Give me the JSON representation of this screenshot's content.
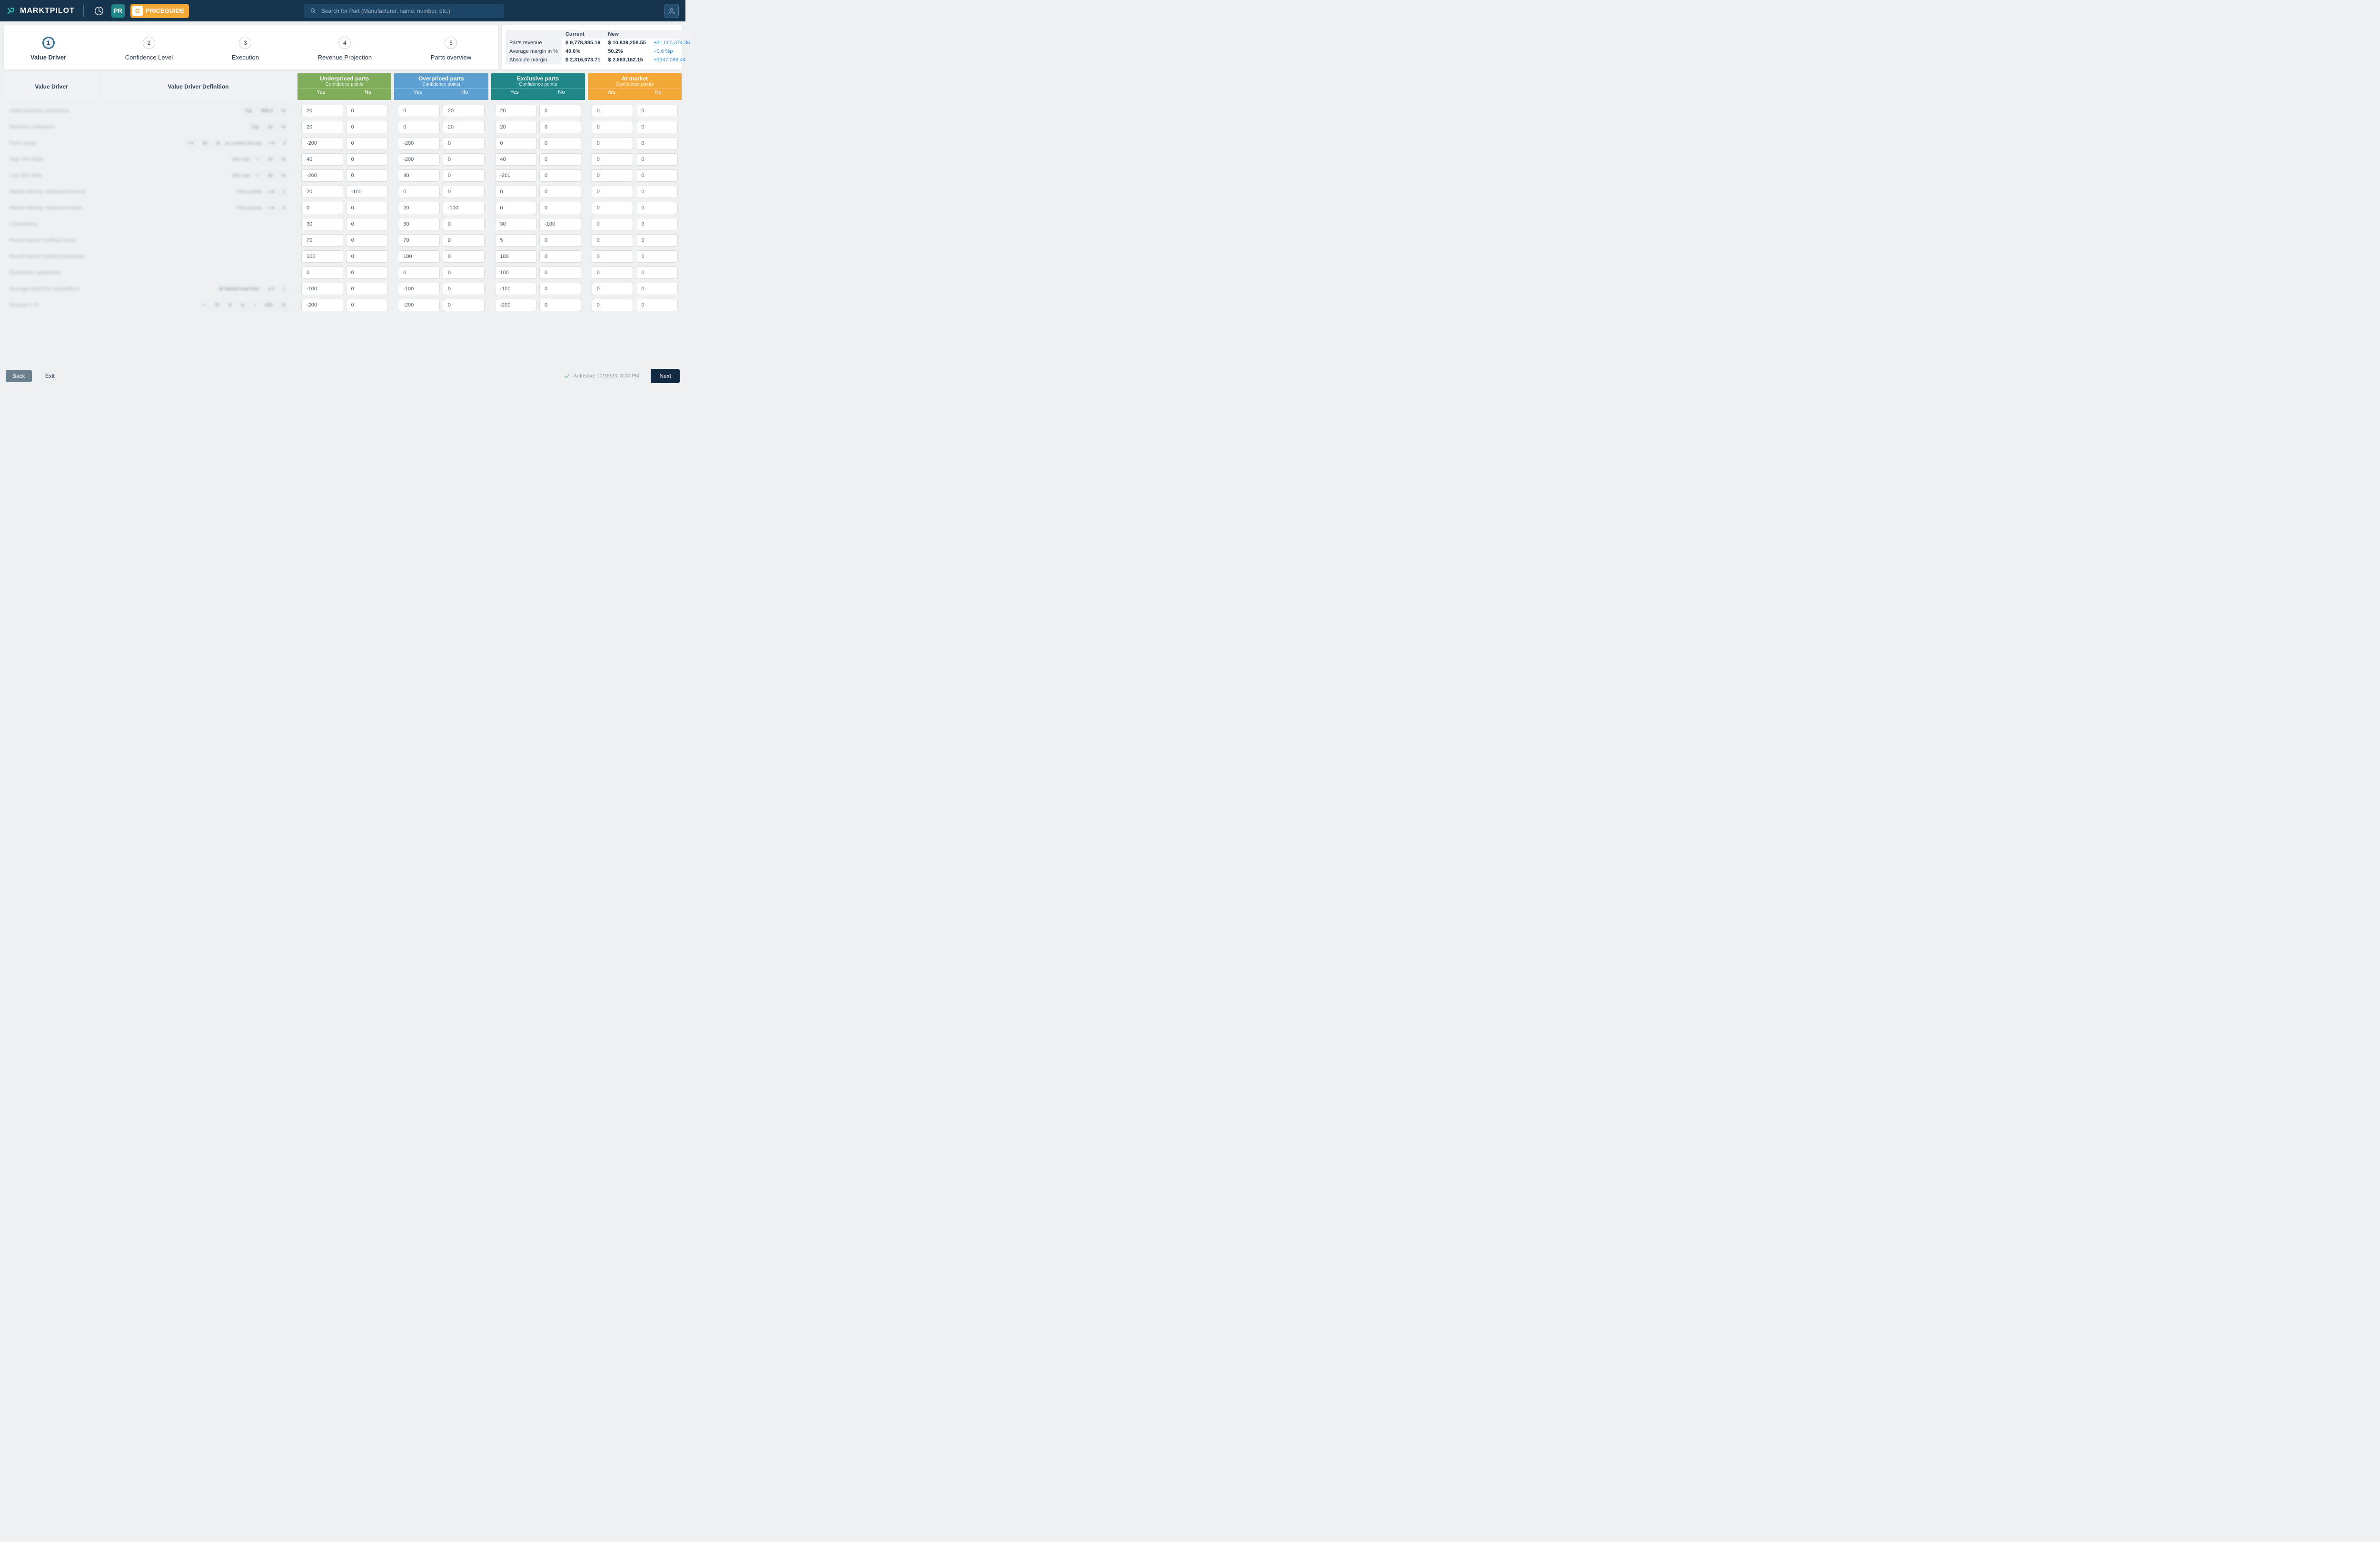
{
  "header": {
    "brand": "MARKTPILOT",
    "priceguide_label": "PRICEGUIDE",
    "priceguide_g": "G",
    "pr_icon_label": "PR",
    "search_placeholder": "Search for Part (Manufacturer, name, number, etc.)"
  },
  "stepper": {
    "steps": [
      {
        "num": "1",
        "label": "Value Driver",
        "active": true
      },
      {
        "num": "2",
        "label": "Confidence Level",
        "active": false
      },
      {
        "num": "3",
        "label": "Execution",
        "active": false
      },
      {
        "num": "4",
        "label": "Revenue Projection",
        "active": false
      },
      {
        "num": "5",
        "label": "Parts overview",
        "active": false
      }
    ]
  },
  "projection": {
    "headers": {
      "current": "Current",
      "new": "New"
    },
    "rows": [
      {
        "label": "Parts revenue",
        "current": "$ 9,778,885.19",
        "new": "$ 10,839,258.55",
        "delta": "+$1,060,374.36"
      },
      {
        "label": "Average margin in %",
        "current": "49.6%",
        "new": "50.2%",
        "delta": "+0.6 %p"
      },
      {
        "label": "Absolute margin",
        "current": "$ 2,316,073.71",
        "new": "$ 2,663,162.15",
        "delta": "+$347,088.44"
      }
    ]
  },
  "grid": {
    "col_value_driver": "Value Driver",
    "col_definition": "Value Driver Definition",
    "conf_label": "Confidence points",
    "yes": "Yes",
    "no": "No",
    "categories": [
      {
        "key": "under",
        "title": "Underpriced parts"
      },
      {
        "key": "over",
        "title": "Overpriced parts"
      },
      {
        "key": "excl",
        "title": "Exclusive parts"
      },
      {
        "key": "mkt",
        "title": "At market"
      }
    ],
    "rows": [
      {
        "label": "Sales quantity champions",
        "def": [
          "Top",
          "999.9",
          "%"
        ],
        "under_y": "20",
        "under_n": "0",
        "over_y": "0",
        "over_n": "20",
        "excl_y": "20",
        "excl_n": "0",
        "mkt_y": "0",
        "mkt_n": "0"
      },
      {
        "label": "Revenue champion",
        "def": [
          "Top",
          "10",
          "%"
        ],
        "under_y": "20",
        "under_n": "0",
        "over_y": "0",
        "over_n": "20",
        "excl_y": "20",
        "excl_n": "0",
        "mkt_y": "0",
        "mkt_n": "0"
      },
      {
        "label": "Price range",
        "def": [
          "< ▾",
          "40",
          "%",
          "at market density",
          "> ▾",
          "4"
        ],
        "under_y": "-200",
        "under_n": "0",
        "over_y": "-200",
        "over_n": "0",
        "excl_y": "0",
        "excl_n": "0",
        "mkt_y": "0",
        "mkt_n": "0"
      },
      {
        "label": "High Win Rate",
        "def": [
          "Win rate",
          "> ",
          "70",
          "%"
        ],
        "under_y": "40",
        "under_n": "0",
        "over_y": "-200",
        "over_n": "0",
        "excl_y": "40",
        "excl_n": "0",
        "mkt_y": "0",
        "mkt_n": "0"
      },
      {
        "label": "Low Win Rate",
        "def": [
          "Win rate",
          "< ",
          "40",
          "%"
        ],
        "under_y": "-200",
        "under_n": "0",
        "over_y": "40",
        "over_n": "0",
        "excl_y": "-200",
        "excl_n": "0",
        "mkt_y": "0",
        "mkt_n": "0"
      },
      {
        "label": "Market density underpriced parts",
        "def": [
          "Price points",
          "≤ ▾",
          "1"
        ],
        "under_y": "20",
        "under_n": "-100",
        "over_y": "0",
        "over_n": "0",
        "excl_y": "0",
        "excl_n": "0",
        "mkt_y": "0",
        "mkt_n": "0"
      },
      {
        "label": "Market density overpriced parts",
        "def": [
          "Price points",
          "> ▾",
          "4"
        ],
        "under_y": "0",
        "under_n": "0",
        "over_y": "20",
        "over_n": "-100",
        "excl_y": "0",
        "excl_n": "0",
        "mkt_y": "0",
        "mkt_n": "0"
      },
      {
        "label": "Consistency",
        "def": [],
        "under_y": "30",
        "under_n": "0",
        "over_y": "30",
        "over_n": "0",
        "excl_y": "30",
        "excl_n": "-100",
        "mkt_y": "0",
        "mkt_n": "0"
      },
      {
        "label": "Result search method Sonar",
        "def": [],
        "under_y": "70",
        "under_n": "0",
        "over_y": "70",
        "over_n": "0",
        "excl_y": "5",
        "excl_n": "0",
        "mkt_y": "0",
        "mkt_n": "0"
      },
      {
        "label": "Result search method DeepDive",
        "def": [],
        "under_y": "100",
        "under_n": "0",
        "over_y": "100",
        "over_n": "0",
        "excl_y": "100",
        "excl_n": "0",
        "mkt_y": "0",
        "mkt_n": "0"
      },
      {
        "label": "Exclusivity agreement",
        "def": [],
        "under_y": "0",
        "under_n": "0",
        "over_y": "0",
        "over_n": "0",
        "excl_y": "100",
        "excl_n": "0",
        "mkt_y": "0",
        "mkt_n": "0"
      },
      {
        "label": "Average lead time competitors",
        "def": [
          "Ø Market lead time",
          "≥ ▾",
          "1"
        ],
        "under_y": "-100",
        "under_n": "0",
        "over_y": "-100",
        "over_n": "0",
        "excl_y": "-100",
        "excl_n": "0",
        "mkt_y": "0",
        "mkt_n": "0"
      },
      {
        "label": "Markup in %",
        "def": [
          "< ",
          "70",
          "%",
          "or",
          "> ",
          "400",
          "%"
        ],
        "under_y": "-200",
        "under_n": "0",
        "over_y": "-200",
        "over_n": "0",
        "excl_y": "-200",
        "excl_n": "0",
        "mkt_y": "0",
        "mkt_n": "0"
      }
    ]
  },
  "footer": {
    "back": "Back",
    "exit": "Exit",
    "next": "Next",
    "autosave": "Autosave 10/16/23, 3:24 PM"
  }
}
